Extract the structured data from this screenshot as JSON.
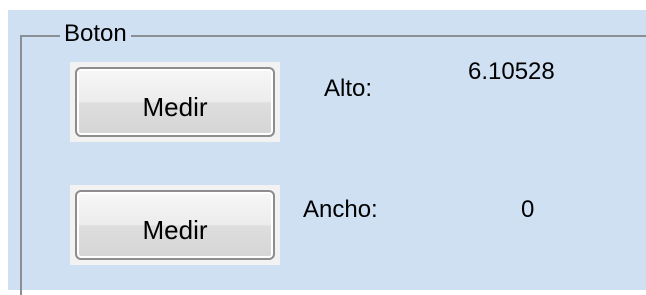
{
  "group": {
    "title": "Boton"
  },
  "row1": {
    "button_label": "Medir",
    "label": "Alto:",
    "value": "6.10528"
  },
  "row2": {
    "button_label": "Medir",
    "label": "Ancho:",
    "value": "0"
  }
}
